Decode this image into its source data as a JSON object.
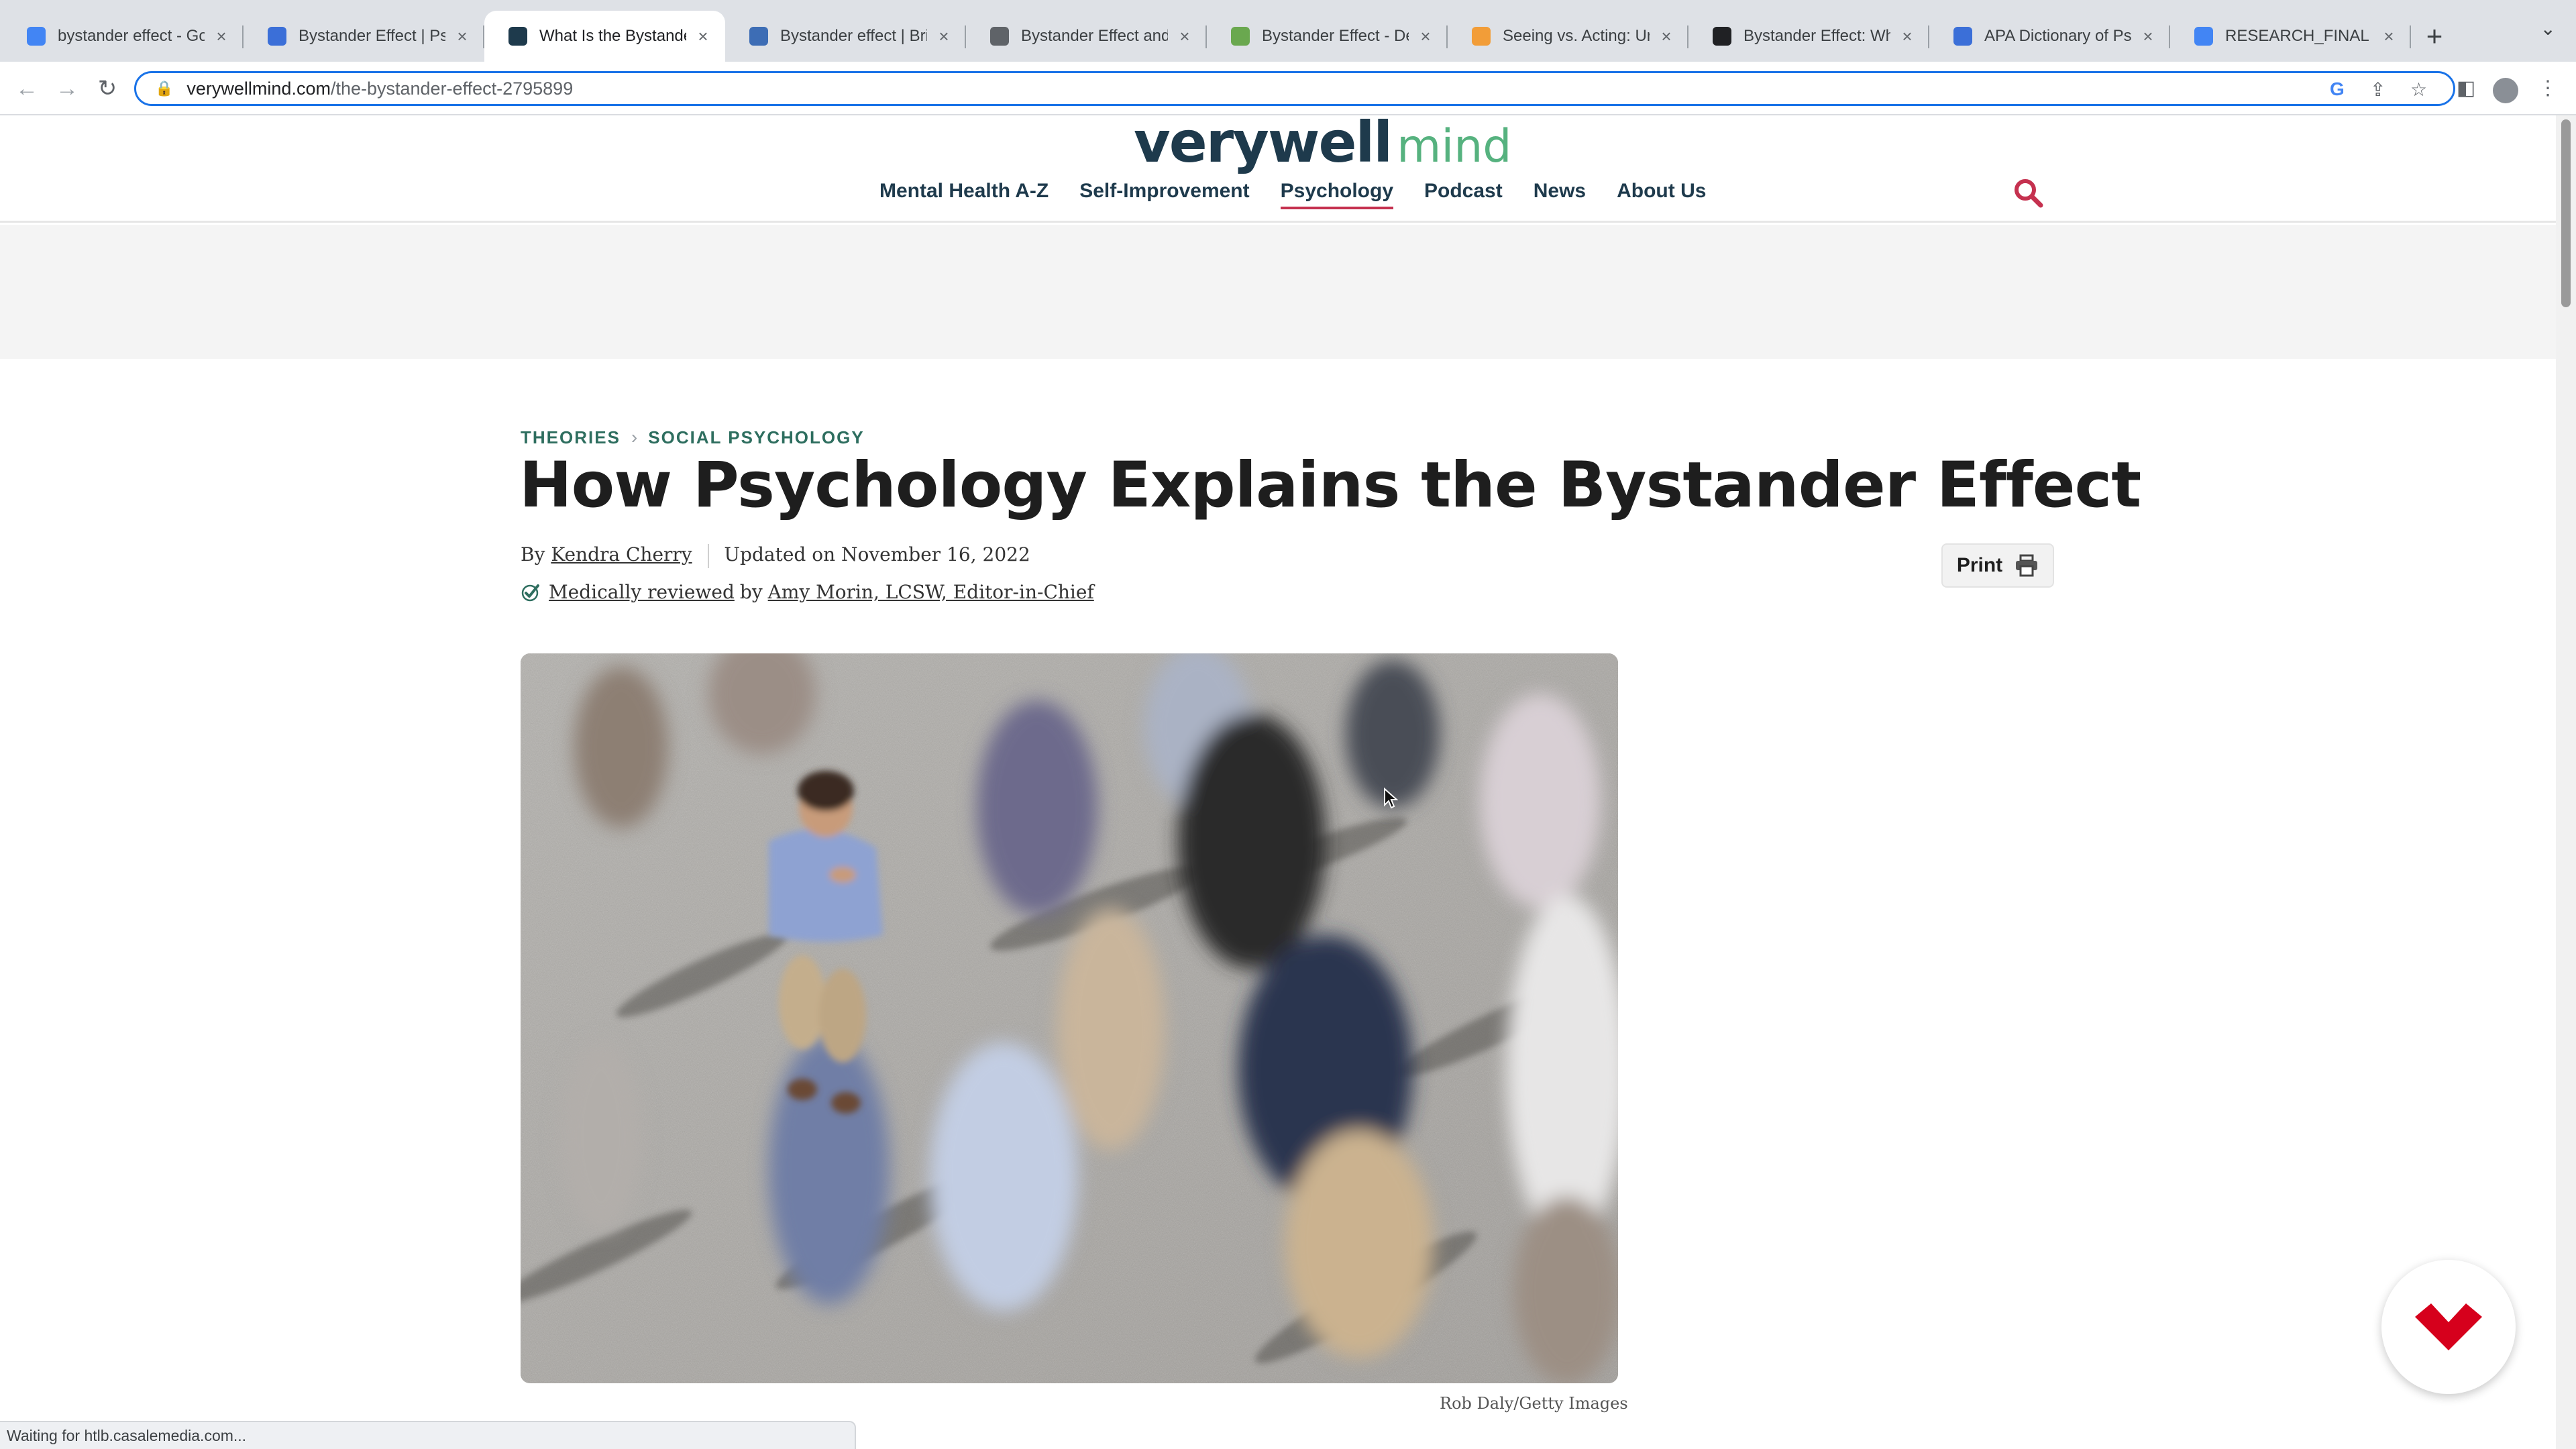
{
  "browser": {
    "tabs": [
      {
        "title": "bystander effect - Goo",
        "favicon": "google-icon",
        "favicon_color": "#4285f4",
        "active": false
      },
      {
        "title": "Bystander Effect | Psyc",
        "favicon": "psychology-today-icon",
        "favicon_color": "#3b6fd8",
        "active": false
      },
      {
        "title": "What Is the Bystander",
        "favicon": "verywell-icon",
        "favicon_color": "#1e3a4c",
        "active": true
      },
      {
        "title": "Bystander effect | Brita",
        "favicon": "britannica-icon",
        "favicon_color": "#3d6db5",
        "active": false
      },
      {
        "title": "Bystander Effect and D",
        "favicon": "globe-icon",
        "favicon_color": "#5f6368",
        "active": false
      },
      {
        "title": "Bystander Effect - Defi",
        "favicon": "leaf-icon",
        "favicon_color": "#6aa84f",
        "active": false
      },
      {
        "title": "Seeing vs. Acting: Und",
        "favicon": "orange-circle-icon",
        "favicon_color": "#f29d38",
        "active": false
      },
      {
        "title": "Bystander Effect: Wha",
        "favicon": "dark-circle-icon",
        "favicon_color": "#202124",
        "active": false
      },
      {
        "title": "APA Dictionary of Psyc",
        "favicon": "apa-icon",
        "favicon_color": "#3b6fd8",
        "active": false
      },
      {
        "title": "RESEARCH_FINAL PRO",
        "favicon": "docs-icon",
        "favicon_color": "#4285f4",
        "active": false
      }
    ],
    "url_host": "verywellmind.com",
    "url_path": "/the-bystander-effect-2795899",
    "status_text": "Waiting for htlb.casalemedia.com..."
  },
  "site": {
    "logo_part1": "verywell",
    "logo_part2": "mind",
    "nav": [
      {
        "label": "Mental Health A-Z",
        "current": false
      },
      {
        "label": "Self-Improvement",
        "current": false
      },
      {
        "label": "Psychology",
        "current": true
      },
      {
        "label": "Podcast",
        "current": false
      },
      {
        "label": "News",
        "current": false
      },
      {
        "label": "About Us",
        "current": false
      }
    ]
  },
  "article": {
    "breadcrumb": [
      "THEORIES",
      "SOCIAL PSYCHOLOGY"
    ],
    "title": "How Psychology Explains the Bystander Effect",
    "by_prefix": "By",
    "author": "Kendra Cherry",
    "updated": "Updated on November 16, 2022",
    "reviewed_link": "Medically reviewed",
    "reviewed_by": "by",
    "reviewer": "Amy Morin, LCSW, Editor-in-Chief",
    "print_label": "Print",
    "image_caption": "Rob Daly/Getty Images"
  },
  "colors": {
    "brand_dark": "#1e3a4c",
    "brand_green": "#56b27f",
    "nav_underline": "#c5314f",
    "breadcrumb": "#2e6e5f",
    "search_icon": "#c5314f",
    "widget_red": "#d6001c",
    "omnibox_focus": "#1a73e8"
  }
}
